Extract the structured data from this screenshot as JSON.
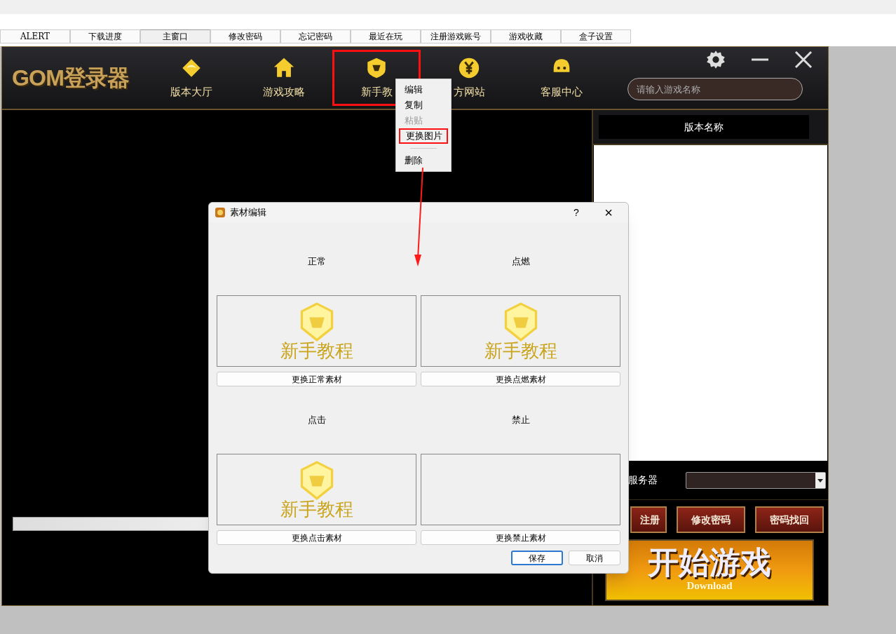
{
  "top_tabs": [
    {
      "label": "ALERT",
      "selected": false
    },
    {
      "label": "下载进度",
      "selected": false
    },
    {
      "label": "主窗口",
      "selected": true
    },
    {
      "label": "修改密码",
      "selected": false
    },
    {
      "label": "忘记密码",
      "selected": false
    },
    {
      "label": "最近在玩",
      "selected": false
    },
    {
      "label": "注册游戏账号",
      "selected": false
    },
    {
      "label": "游戏收藏",
      "selected": false
    },
    {
      "label": "盒子设置",
      "selected": false
    }
  ],
  "launcher": {
    "logo": "GOM登录器",
    "nav": [
      {
        "label": "版本大厅",
        "selected": false
      },
      {
        "label": "游戏攻略",
        "selected": false
      },
      {
        "label": "新手教",
        "selected": true
      },
      {
        "label": "方网站",
        "selected": false
      },
      {
        "label": "客服中心",
        "selected": false
      }
    ],
    "search": {
      "placeholder": "请输入游戏名称"
    },
    "version_header": "版本名称",
    "server_label": "服务器",
    "account_buttons": [
      "注册",
      "修改密码",
      "密码找回"
    ],
    "start_banner": {
      "title": "开始游戏",
      "subtitle": "Download"
    }
  },
  "context_menu": [
    {
      "label": "编辑",
      "disabled": false,
      "selected": false
    },
    {
      "label": "复制",
      "disabled": false,
      "selected": false
    },
    {
      "label": "粘贴",
      "disabled": true,
      "selected": false
    },
    {
      "label": "更换图片",
      "disabled": false,
      "selected": true
    },
    {
      "label": "删除",
      "disabled": false,
      "selected": false
    }
  ],
  "dialog": {
    "title": "素材编辑",
    "help": "?",
    "close": "×",
    "states": [
      {
        "label": "正常",
        "preview": "新手教程",
        "button": "更换正常素材"
      },
      {
        "label": "点燃",
        "preview": "新手教程",
        "button": "更换点燃素材"
      },
      {
        "label": "点击",
        "preview": "新手教程",
        "button": "更换点击素材"
      },
      {
        "label": "禁止",
        "button": "更换禁止素材"
      }
    ],
    "buttons": [
      {
        "label": "保存",
        "default": true
      },
      {
        "label": "取消",
        "default": false
      }
    ]
  }
}
